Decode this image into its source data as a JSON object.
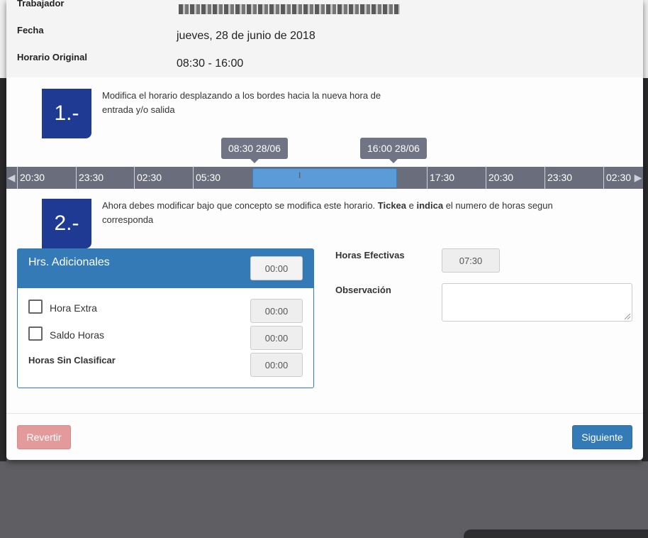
{
  "header": {
    "worker_label": "Trabajador",
    "date_label": "Fecha",
    "date_value": "jueves, 28 de junio de 2018",
    "schedule_label": "Horario Original",
    "schedule_value": "08:30 - 16:00"
  },
  "step1": {
    "number": "1.-",
    "text": "Modifica el horario desplazando a los bordes hacia la nueva hora de entrada y/o salida"
  },
  "timeline": {
    "start_tooltip": "08:30 28/06",
    "end_tooltip": "16:00 28/06",
    "ticks": [
      "20:30",
      "23:30",
      "02:30",
      "05:30",
      "17:30",
      "20:30",
      "23:30",
      "02:30"
    ]
  },
  "step2": {
    "number": "2.-",
    "text_a": "Ahora debes modificar bajo que concepto se modifica este horario. ",
    "bold_1": "Tickea",
    "text_b": " e ",
    "bold_2": "indica",
    "text_c": " el numero de horas segun corresponda"
  },
  "panel": {
    "title": "Hrs. Adicionales",
    "total": "00:00",
    "extra_label": "Hora Extra",
    "extra_value": "00:00",
    "saldo_label": "Saldo Horas",
    "saldo_value": "00:00",
    "sin_clasificar_label": "Horas Sin Clasificar",
    "sin_clasificar_value": "00:00"
  },
  "right": {
    "effective_label": "Horas Efectivas",
    "effective_value": "07:30",
    "observation_label": "Observación"
  },
  "footer": {
    "revert_label": "Revertir",
    "next_label": "Siguiente"
  },
  "colors": {
    "primary": "#337ab7",
    "step_box": "#1f3a93",
    "danger_disabled": "#e29b9a",
    "timeline_bg": "#6a6d7c",
    "range": "#5b9bd8"
  }
}
